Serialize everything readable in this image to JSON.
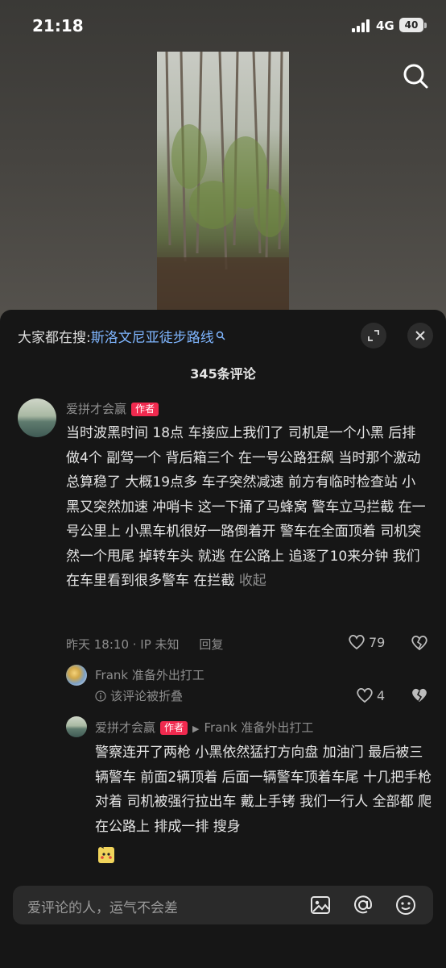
{
  "status_bar": {
    "time": "21:18",
    "network": "4G",
    "battery": "40"
  },
  "video": {
    "search_icon": "search-icon"
  },
  "comments_panel": {
    "search_hint": {
      "prefix": "大家都在搜:",
      "query": "斯洛文尼亚徒步路线"
    },
    "title": "345条评论",
    "comments": [
      {
        "author": "爱拼才会赢",
        "badge": "作者",
        "text": "当时波黑时间 18点 车接应上我们了 司机是一个小黑 后排做4个 副驾一个 背后箱三个 在一号公路狂飙 当时那个激动 总算稳了 大概19点多 车子突然减速 前方有临时检查站 小黑又突然加速 冲哨卡 这一下捅了马蜂窝 警车立马拦截 在一号公里上 小黑车机很好一路倒着开 警车在全面顶着 司机突然一个甩尾 掉转车头 就逃 在公路上 追逐了10来分钟 我们在车里看到很多警车 在拦截",
        "collapse_label": "收起",
        "time_location": "昨天 18:10 · IP 未知",
        "reply_label": "回复",
        "likes": "79"
      },
      {
        "author": "Frank 准备外出打工",
        "folded_text": "该评论被折叠",
        "likes": "4"
      },
      {
        "author": "爱拼才会赢",
        "badge": "作者",
        "reply_to": "Frank 准备外出打工",
        "text": "警察连开了两枪 小黑依然猛打方向盘 加油门 最后被三辆警车 前面2辆顶着 后面一辆警车顶着车尾 十几把手枪对着 司机被强行拉出车 戴上手铐 我们一行人 全部都 爬在公路上 排成一排 搜身"
      }
    ]
  },
  "input": {
    "placeholder": "爱评论的人，运气不会差"
  }
}
